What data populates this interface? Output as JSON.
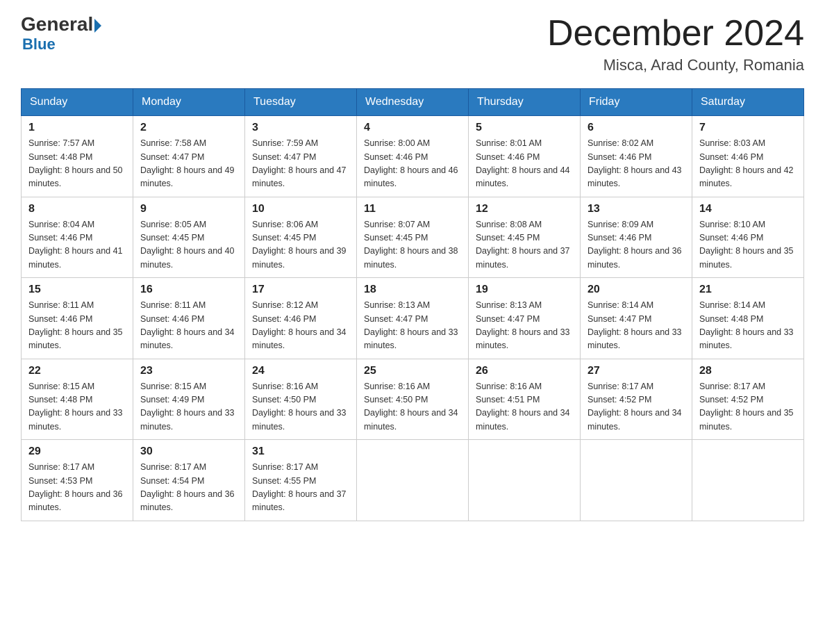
{
  "header": {
    "logo_line1": "General",
    "logo_line2": "Blue",
    "month_title": "December 2024",
    "location": "Misca, Arad County, Romania"
  },
  "weekdays": [
    "Sunday",
    "Monday",
    "Tuesday",
    "Wednesday",
    "Thursday",
    "Friday",
    "Saturday"
  ],
  "weeks": [
    [
      {
        "day": "1",
        "sunrise": "7:57 AM",
        "sunset": "4:48 PM",
        "daylight": "8 hours and 50 minutes."
      },
      {
        "day": "2",
        "sunrise": "7:58 AM",
        "sunset": "4:47 PM",
        "daylight": "8 hours and 49 minutes."
      },
      {
        "day": "3",
        "sunrise": "7:59 AM",
        "sunset": "4:47 PM",
        "daylight": "8 hours and 47 minutes."
      },
      {
        "day": "4",
        "sunrise": "8:00 AM",
        "sunset": "4:46 PM",
        "daylight": "8 hours and 46 minutes."
      },
      {
        "day": "5",
        "sunrise": "8:01 AM",
        "sunset": "4:46 PM",
        "daylight": "8 hours and 44 minutes."
      },
      {
        "day": "6",
        "sunrise": "8:02 AM",
        "sunset": "4:46 PM",
        "daylight": "8 hours and 43 minutes."
      },
      {
        "day": "7",
        "sunrise": "8:03 AM",
        "sunset": "4:46 PM",
        "daylight": "8 hours and 42 minutes."
      }
    ],
    [
      {
        "day": "8",
        "sunrise": "8:04 AM",
        "sunset": "4:46 PM",
        "daylight": "8 hours and 41 minutes."
      },
      {
        "day": "9",
        "sunrise": "8:05 AM",
        "sunset": "4:45 PM",
        "daylight": "8 hours and 40 minutes."
      },
      {
        "day": "10",
        "sunrise": "8:06 AM",
        "sunset": "4:45 PM",
        "daylight": "8 hours and 39 minutes."
      },
      {
        "day": "11",
        "sunrise": "8:07 AM",
        "sunset": "4:45 PM",
        "daylight": "8 hours and 38 minutes."
      },
      {
        "day": "12",
        "sunrise": "8:08 AM",
        "sunset": "4:45 PM",
        "daylight": "8 hours and 37 minutes."
      },
      {
        "day": "13",
        "sunrise": "8:09 AM",
        "sunset": "4:46 PM",
        "daylight": "8 hours and 36 minutes."
      },
      {
        "day": "14",
        "sunrise": "8:10 AM",
        "sunset": "4:46 PM",
        "daylight": "8 hours and 35 minutes."
      }
    ],
    [
      {
        "day": "15",
        "sunrise": "8:11 AM",
        "sunset": "4:46 PM",
        "daylight": "8 hours and 35 minutes."
      },
      {
        "day": "16",
        "sunrise": "8:11 AM",
        "sunset": "4:46 PM",
        "daylight": "8 hours and 34 minutes."
      },
      {
        "day": "17",
        "sunrise": "8:12 AM",
        "sunset": "4:46 PM",
        "daylight": "8 hours and 34 minutes."
      },
      {
        "day": "18",
        "sunrise": "8:13 AM",
        "sunset": "4:47 PM",
        "daylight": "8 hours and 33 minutes."
      },
      {
        "day": "19",
        "sunrise": "8:13 AM",
        "sunset": "4:47 PM",
        "daylight": "8 hours and 33 minutes."
      },
      {
        "day": "20",
        "sunrise": "8:14 AM",
        "sunset": "4:47 PM",
        "daylight": "8 hours and 33 minutes."
      },
      {
        "day": "21",
        "sunrise": "8:14 AM",
        "sunset": "4:48 PM",
        "daylight": "8 hours and 33 minutes."
      }
    ],
    [
      {
        "day": "22",
        "sunrise": "8:15 AM",
        "sunset": "4:48 PM",
        "daylight": "8 hours and 33 minutes."
      },
      {
        "day": "23",
        "sunrise": "8:15 AM",
        "sunset": "4:49 PM",
        "daylight": "8 hours and 33 minutes."
      },
      {
        "day": "24",
        "sunrise": "8:16 AM",
        "sunset": "4:50 PM",
        "daylight": "8 hours and 33 minutes."
      },
      {
        "day": "25",
        "sunrise": "8:16 AM",
        "sunset": "4:50 PM",
        "daylight": "8 hours and 34 minutes."
      },
      {
        "day": "26",
        "sunrise": "8:16 AM",
        "sunset": "4:51 PM",
        "daylight": "8 hours and 34 minutes."
      },
      {
        "day": "27",
        "sunrise": "8:17 AM",
        "sunset": "4:52 PM",
        "daylight": "8 hours and 34 minutes."
      },
      {
        "day": "28",
        "sunrise": "8:17 AM",
        "sunset": "4:52 PM",
        "daylight": "8 hours and 35 minutes."
      }
    ],
    [
      {
        "day": "29",
        "sunrise": "8:17 AM",
        "sunset": "4:53 PM",
        "daylight": "8 hours and 36 minutes."
      },
      {
        "day": "30",
        "sunrise": "8:17 AM",
        "sunset": "4:54 PM",
        "daylight": "8 hours and 36 minutes."
      },
      {
        "day": "31",
        "sunrise": "8:17 AM",
        "sunset": "4:55 PM",
        "daylight": "8 hours and 37 minutes."
      },
      null,
      null,
      null,
      null
    ]
  ],
  "labels": {
    "sunrise_prefix": "Sunrise: ",
    "sunset_prefix": "Sunset: ",
    "daylight_prefix": "Daylight: "
  }
}
